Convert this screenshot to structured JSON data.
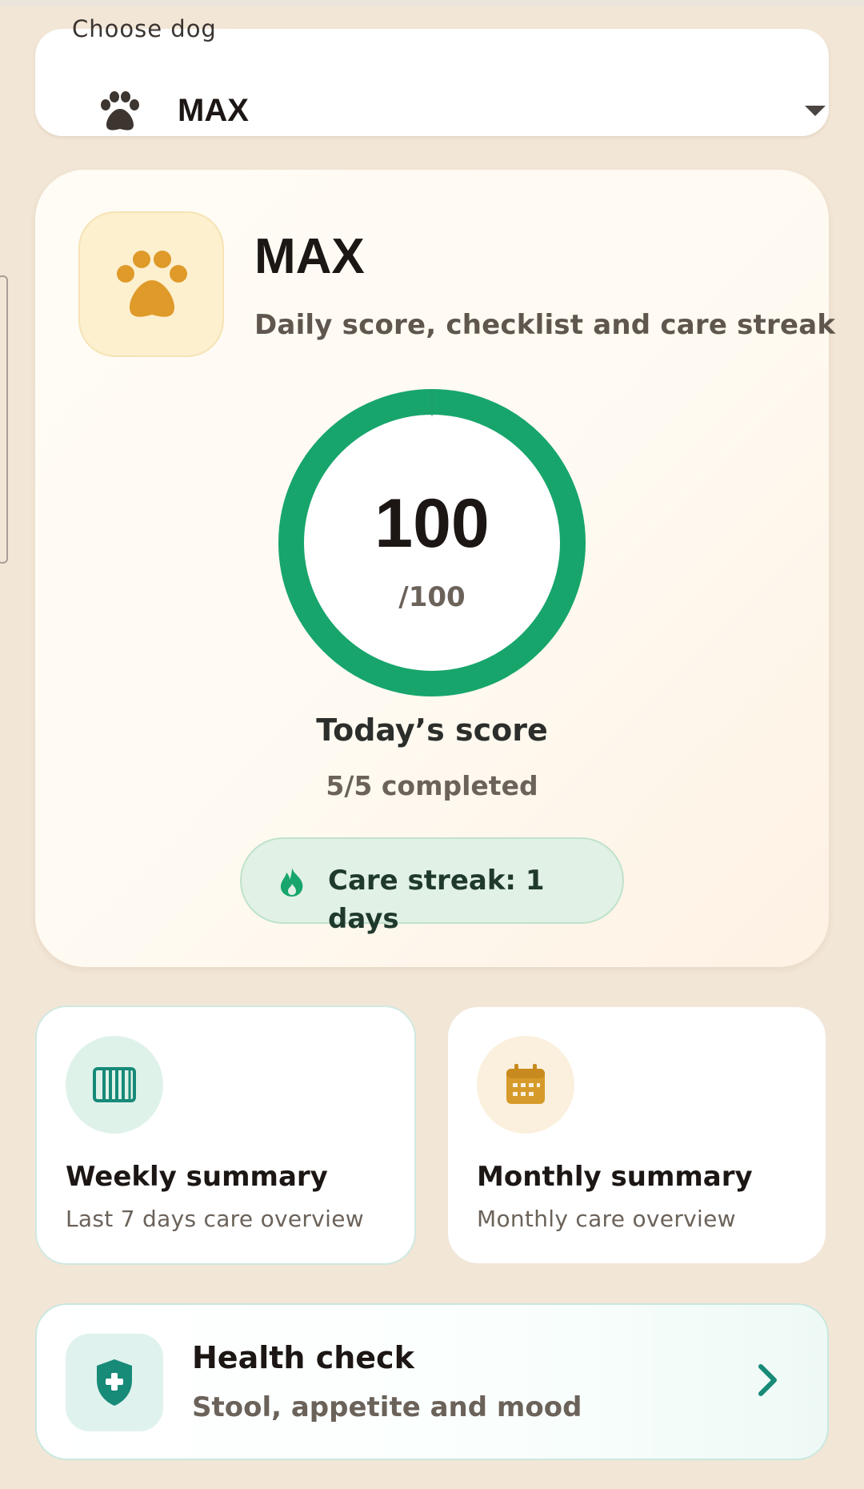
{
  "dog_selector": {
    "label": "Choose dog",
    "value": "MAX",
    "icon": "paw-icon",
    "caret_icon": "dropdown-caret-icon"
  },
  "profile": {
    "name": "MAX",
    "subtitle": "Daily score, checklist and care streak",
    "avatar_icon": "paw-icon"
  },
  "score": {
    "value": "100",
    "max_label": "/100",
    "fraction": 1.0,
    "title": "Today’s score",
    "progress_text": "5/5 completed"
  },
  "streak": {
    "icon": "flame-icon",
    "text": "Care streak: 1 days"
  },
  "tiles": [
    {
      "id": "weekly",
      "icon": "calendar-week-icon",
      "title": "Weekly summary",
      "subtitle": "Last 7 days care overview"
    },
    {
      "id": "monthly",
      "icon": "calendar-month-icon",
      "title": "Monthly summary",
      "subtitle": "Monthly care overview"
    }
  ],
  "health_check": {
    "icon": "shield-plus-icon",
    "title": "Health check",
    "subtitle": "Stool, appetite and mood",
    "chevron_icon": "chevron-right-icon"
  },
  "colors": {
    "background": "#f2e6d6",
    "score_ring": "#17a56b",
    "paw_gold": "#df9a2a",
    "teal": "#178a78",
    "amber": "#d69a2a"
  }
}
